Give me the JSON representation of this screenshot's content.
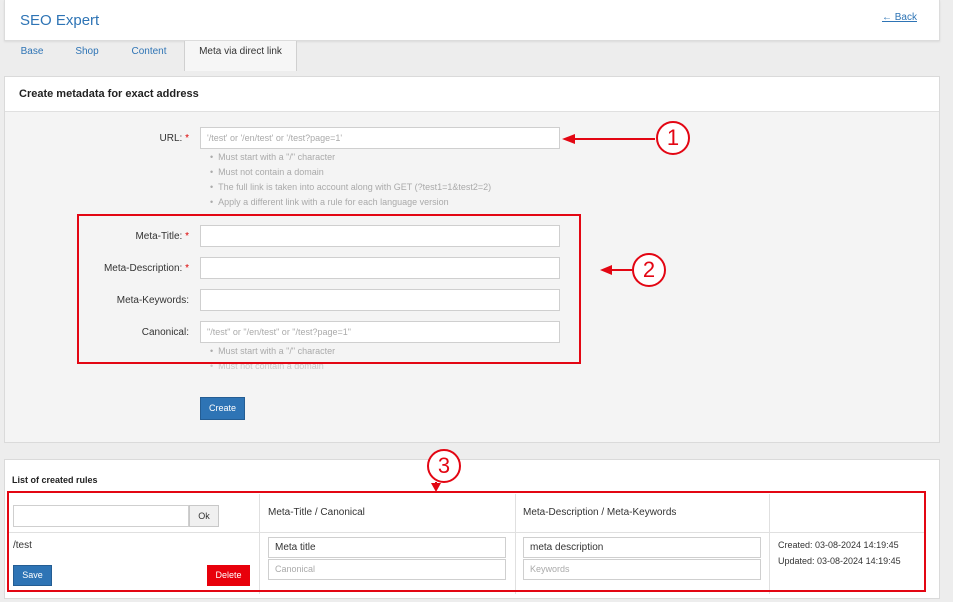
{
  "header": {
    "title": "SEO Expert",
    "back_label": "← Back"
  },
  "tabs": [
    {
      "label": "Base"
    },
    {
      "label": "Shop"
    },
    {
      "label": "Content"
    },
    {
      "label": "Meta via direct link",
      "active": true
    }
  ],
  "create_form": {
    "heading": "Create metadata for exact address",
    "url": {
      "label": "URL:",
      "required_mark": "*",
      "placeholder": "'/test' or '/en/test' or '/test?page=1'",
      "hints": [
        "Must start with a \"/\" character",
        "Must not contain a domain",
        "The full link is taken into account along with GET (?test1=1&test2=2)",
        "Apply a different link with a rule for each language version"
      ]
    },
    "meta_title": {
      "label": "Meta-Title:",
      "required_mark": "*",
      "value": ""
    },
    "meta_description": {
      "label": "Meta-Description:",
      "required_mark": "*",
      "value": ""
    },
    "meta_keywords": {
      "label": "Meta-Keywords:",
      "value": ""
    },
    "canonical": {
      "label": "Canonical:",
      "placeholder": "\"/test\" or \"/en/test\" or \"/test?page=1\"",
      "hints": [
        "Must start with a \"/\" character",
        "Must not contain a domain"
      ]
    },
    "create_button": "Create"
  },
  "rules_list": {
    "heading": "List of created rules",
    "filter_value": "",
    "ok_button": "Ok",
    "columns": [
      "Meta-Title / Canonical",
      "Meta-Description / Meta-Keywords"
    ],
    "rows": [
      {
        "url": "/test",
        "meta_title": "Meta title",
        "canonical_placeholder": "Canonical",
        "meta_description": "meta description",
        "keywords_placeholder": "Keywords",
        "created": "Created: 03-08-2024 14:19:45",
        "updated": "Updated: 03-08-2024 14:19:45",
        "save_button": "Save",
        "delete_button": "Delete"
      }
    ]
  },
  "annotations": {
    "callout_1": "1",
    "callout_2": "2",
    "callout_3": "3",
    "color": "#e30613"
  }
}
